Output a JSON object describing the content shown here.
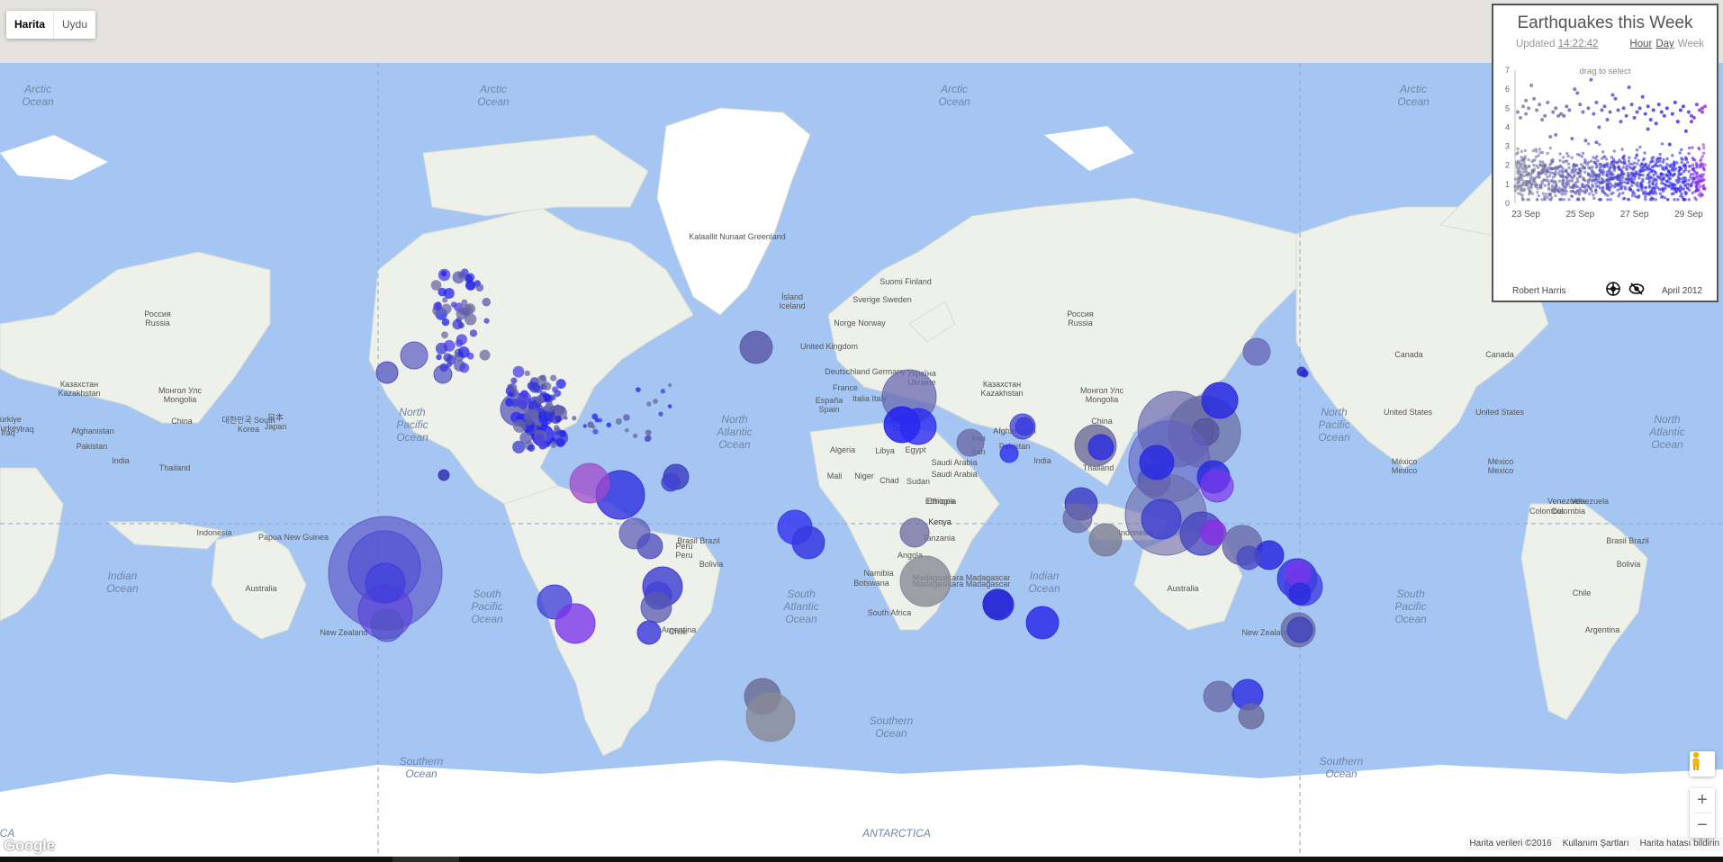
{
  "map_type": {
    "map_label": "Harita",
    "satellite_label": "Uydu"
  },
  "oceans": [
    "Arctic Ocean",
    "Arctic Ocean",
    "Arctic Ocean",
    "Arctic Ocean",
    "North Pacific Ocean",
    "North Atlantic Ocean",
    "North Pacific Ocean",
    "North Atlantic Ocean",
    "Indian Ocean",
    "South Pacific Ocean",
    "South Atlantic Ocean",
    "Indian Ocean",
    "South Pacific Ocean",
    "Southern Ocean",
    "Southern Ocean",
    "Southern Ocean",
    "ANTARCTICA",
    "CA"
  ],
  "places": [
    "Kalaallit Nunaat Greenland",
    "Ísland Iceland",
    "Suomi Finland",
    "Sverige Sweden",
    "Norge Norway",
    "United Kingdom",
    "Deutschland Germany",
    "Україна Ukraine",
    "France",
    "España Spain",
    "Italia Italy",
    "Türkiye Turkey",
    "Algeria",
    "Libya",
    "Egypt",
    "Iran",
    "Saudi Arabia",
    "Mali",
    "Niger",
    "Chad",
    "Sudan",
    "Ethiopia",
    "Kenya",
    "Tanzania",
    "Angola",
    "Namibia",
    "Botswana",
    "South Africa",
    "Madagasikara Madagascar",
    "Россия Russia",
    "Казахстан Kazakhstan",
    "Монгол Улс Mongolia",
    "China",
    "India",
    "Thailand",
    "Indonesia",
    "Papua New Guinea",
    "Australia",
    "New Zealand",
    "日本 Japan",
    "대한민국 South Korea",
    "Afghanistan",
    "Pakistan",
    "Iraq",
    "Canada",
    "United States",
    "México Mexico",
    "Venezuela",
    "Colombia",
    "Perú Peru",
    "Brasil Brazil",
    "Bolivia",
    "Chile",
    "Argentina",
    "Россия Russia",
    "Казахстан Kazakhstan",
    "Монгол Улс Mongolia",
    "China",
    "India",
    "Thailand",
    "Indonesia",
    "Australia",
    "New Zealand",
    "Afghanistan",
    "Pakistan",
    "Canada",
    "United States",
    "México Mexico",
    "Venezuela",
    "Colombia",
    "Brasil Brazil",
    "Bolivia",
    "Chile",
    "Argentina",
    "Türkiye Turkey",
    "Iraq",
    "Iran",
    "Saudi Arabia",
    "Ethiopia",
    "Kenya",
    "Madagasikara Madagascar"
  ],
  "attribution": {
    "data": "Harita verileri ©2016",
    "terms": "Kullanım Şartları",
    "report": "Harita hatası bildirin"
  },
  "google_logo": "Google",
  "zoom": {
    "in": "+",
    "out": "−"
  },
  "panel": {
    "title": "Earthquakes this Week",
    "updated_prefix": "Updated",
    "updated_time": "14:22:42",
    "ranges": {
      "hour": "Hour",
      "day": "Day",
      "week": "Week"
    },
    "drag_hint": "drag to select",
    "author": "Robert Harris",
    "date": "April 2012"
  },
  "chart_data": {
    "type": "scatter",
    "title": "",
    "xlabel": "",
    "ylabel": "",
    "ylim": [
      0,
      7
    ],
    "yticks": [
      0,
      1,
      2,
      3,
      4,
      5,
      6,
      7
    ],
    "xticks": [
      "23 Sep",
      "25 Sep",
      "27 Sep",
      "29 Sep"
    ],
    "x_range_days": [
      0,
      7.1
    ],
    "color_old": "#7d7d9a",
    "color_recent": "#2a20f0",
    "color_latest": "#9a2ae0",
    "series": [
      {
        "values_note_free": true,
        "x": [
          0.1,
          0.3,
          0.4,
          0.5,
          0.6,
          0.8,
          0.9,
          1.1,
          1.2,
          1.4,
          1.5,
          1.7,
          1.9,
          2.0,
          2.2,
          2.4,
          2.5,
          2.7,
          2.9,
          3.0,
          3.2,
          3.3,
          3.5,
          3.7,
          3.8,
          4.0,
          4.1,
          4.3,
          4.5,
          4.6,
          4.8,
          4.9,
          5.1,
          5.3,
          5.4,
          5.6,
          5.8,
          5.9,
          6.1,
          6.2,
          6.4,
          6.5,
          6.7,
          6.8,
          6.9,
          7.0,
          0.2,
          1.0,
          1.6,
          2.3,
          2.8,
          3.4,
          3.9,
          4.4,
          5.0,
          5.5,
          6.0,
          6.6,
          0.7,
          2.1,
          3.6,
          5.2,
          6.3,
          1.3,
          2.6,
          4.2,
          5.7,
          6.9,
          0.4,
          1.8,
          3.1,
          4.7,
          6.5,
          1.5,
          3.0,
          4.9
        ],
        "y": [
          4.8,
          5.1,
          4.7,
          5.0,
          6.2,
          4.9,
          5.2,
          4.6,
          5.3,
          4.8,
          5.0,
          4.7,
          5.1,
          4.9,
          6.0,
          5.2,
          4.8,
          5.0,
          4.7,
          5.3,
          4.9,
          5.1,
          4.8,
          5.5,
          4.9,
          5.0,
          4.6,
          5.2,
          4.8,
          5.0,
          4.7,
          5.1,
          4.9,
          5.2,
          4.8,
          5.0,
          4.7,
          5.3,
          4.9,
          5.1,
          4.8,
          4.6,
          5.2,
          4.9,
          5.0,
          5.1,
          4.5,
          4.4,
          4.6,
          5.8,
          6.5,
          4.4,
          4.3,
          4.5,
          4.4,
          4.6,
          4.3,
          4.5,
          5.5,
          3.4,
          5.7,
          4.2,
          3.8,
          3.5,
          3.3,
          6.1,
          3.1,
          4.8,
          5.4,
          4.6,
          4.0,
          5.6,
          4.3,
          3.6,
          3.2,
          3.9
        ]
      }
    ],
    "dense_cloud": {
      "count": 1100,
      "y_range": [
        0.2,
        3.2
      ],
      "mode_y": 1.4
    }
  }
}
